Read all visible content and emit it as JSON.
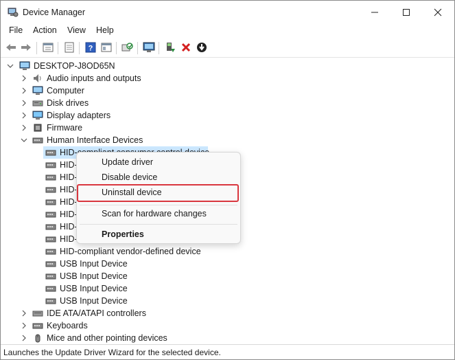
{
  "window": {
    "title": "Device Manager",
    "controls": [
      "minimize",
      "maximize",
      "close"
    ]
  },
  "menu": {
    "items": [
      "File",
      "Action",
      "View",
      "Help"
    ]
  },
  "toolbar": {
    "icons": [
      "back-arrow",
      "forward-arrow",
      "properties-sheet",
      "properties",
      "help",
      "view-details",
      "scan-hardware",
      "monitor",
      "update-driver",
      "uninstall",
      "download"
    ]
  },
  "tree": {
    "root": "DESKTOP-J8OD65N",
    "categories_top": [
      "Audio inputs and outputs",
      "Computer",
      "Disk drives",
      "Display adapters",
      "Firmware",
      "Human Interface Devices"
    ],
    "hid_children": [
      "HID-compliant consumer control device",
      "HID-",
      "HID-",
      "HID-",
      "HID-",
      "HID-",
      "HID-",
      "HID-",
      "HID-compliant vendor-defined device",
      "USB Input Device",
      "USB Input Device",
      "USB Input Device",
      "USB Input Device"
    ],
    "categories_bottom": [
      "IDE ATA/ATAPI controllers",
      "Keyboards",
      "Mice and other pointing devices"
    ]
  },
  "context_menu": {
    "update_driver": "Update driver",
    "disable_device": "Disable device",
    "uninstall_device": "Uninstall device",
    "scan_hardware": "Scan for hardware changes",
    "properties": "Properties"
  },
  "status": {
    "text": "Launches the Update Driver Wizard for the selected device."
  },
  "colors": {
    "selection": "#cce8ff",
    "highlight_border": "#d9363e"
  }
}
